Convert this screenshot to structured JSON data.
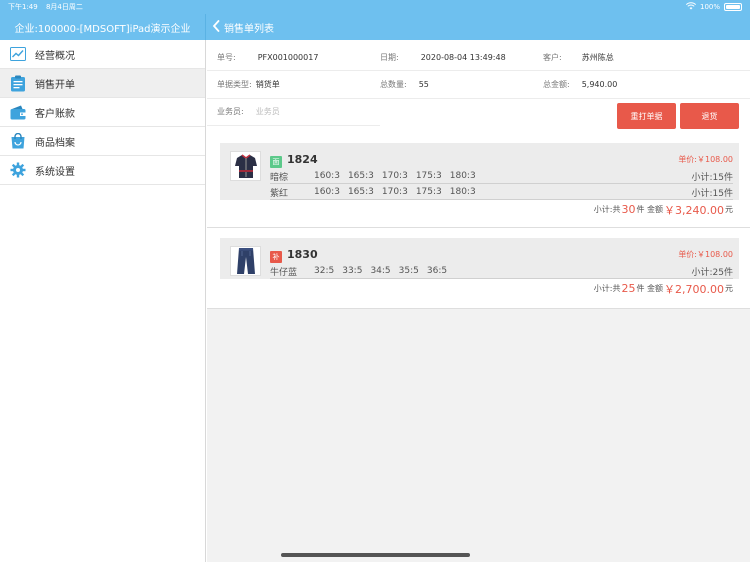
{
  "status_bar": {
    "time": "下午1:49",
    "date": "8月4日周二",
    "battery": "100%"
  },
  "left_header": {
    "title": "企业:100000-[MDSOFT]iPad演示企业"
  },
  "right_header": {
    "back_label": "销售单列表"
  },
  "sidebar": {
    "items": [
      {
        "label": "经营概况",
        "icon": "chart-icon"
      },
      {
        "label": "销售开单",
        "icon": "clipboard-icon"
      },
      {
        "label": "客户账款",
        "icon": "wallet-icon"
      },
      {
        "label": "商品档案",
        "icon": "shopping-bag-icon"
      },
      {
        "label": "系统设置",
        "icon": "gear-icon"
      }
    ],
    "active_index": 1
  },
  "order": {
    "number_label": "单号:",
    "number": "PFX001000017",
    "date_label": "日期:",
    "date": "2020-08-04 13:49:48",
    "customer_label": "客户:",
    "customer": "苏州陈总",
    "type_label": "单据类型:",
    "type": "销货单",
    "qty_label": "总数量:",
    "qty": "55",
    "amount_label": "总金额:",
    "amount": "5,940.00",
    "salesman_label": "业务员:",
    "salesman_placeholder": "业务员"
  },
  "buttons": {
    "reprint": "重打单据",
    "return": "退货"
  },
  "items": [
    {
      "badge": "面",
      "badge_color": "#5cc98a",
      "code": "1824",
      "unit_price": "单价:￥108.00",
      "colors": [
        {
          "name": "暗棕",
          "sizes": [
            "160:3",
            "165:3",
            "170:3",
            "175:3",
            "180:3"
          ],
          "subtotal": "小计:15件"
        },
        {
          "name": "紫红",
          "sizes": [
            "160:3",
            "165:3",
            "170:3",
            "175:3",
            "180:3"
          ],
          "subtotal": "小计:15件"
        }
      ],
      "footer": {
        "prefix": "小计:共",
        "count": "30",
        "mid": "件 金额",
        "amount": "￥3,240.00",
        "suffix": "元"
      }
    },
    {
      "badge": "补",
      "badge_color": "#e8594a",
      "code": "1830",
      "unit_price": "单价:￥108.00",
      "colors": [
        {
          "name": "牛仔蓝",
          "sizes": [
            "32:5",
            "33:5",
            "34:5",
            "35:5",
            "36:5"
          ],
          "subtotal": "小计:25件"
        }
      ],
      "footer": {
        "prefix": "小计:共",
        "count": "25",
        "mid": "件 金额",
        "amount": "￥2,700.00",
        "suffix": "元"
      }
    }
  ],
  "colors": {
    "header_blue": "#6ec0ef",
    "accent_red": "#e8594a"
  }
}
